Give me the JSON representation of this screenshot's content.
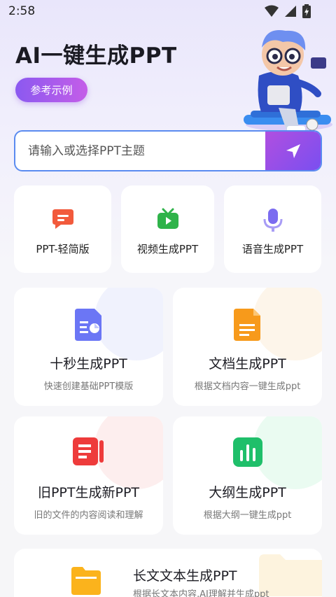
{
  "status": {
    "time": "2:58"
  },
  "hero": {
    "title": "AI一键生成PPT",
    "example_button": "参考示例"
  },
  "search": {
    "placeholder": "请输入或选择PPT主题"
  },
  "quick_tools": [
    {
      "label": "PPT-轻简版",
      "icon": "chat-bubble-icon",
      "color": "#f25a3c"
    },
    {
      "label": "视频生成PPT",
      "icon": "tv-play-icon",
      "color": "#2fb34a"
    },
    {
      "label": "语音生成PPT",
      "icon": "microphone-icon",
      "color": "#7b6cf0"
    }
  ],
  "feature_cards": [
    {
      "title": "十秒生成PPT",
      "subtitle": "快速创建基础PPT模版",
      "icon": "document-chart-icon",
      "color": "#6b76f5"
    },
    {
      "title": "文档生成PPT",
      "subtitle": "根据文档内容一键生成ppt",
      "icon": "document-icon",
      "color": "#f79a1b"
    },
    {
      "title": "旧PPT生成新PPT",
      "subtitle": "旧的文件的内容阅读和理解",
      "icon": "slides-icon",
      "color": "#ee3b3b"
    },
    {
      "title": "大纲生成PPT",
      "subtitle": "根据大纲一键生成ppt",
      "icon": "bar-chart-icon",
      "color": "#1fbf6a"
    }
  ],
  "wide_card": {
    "title": "长文文本生成PPT",
    "subtitle": "根据长文本内容,AI理解并生成ppt",
    "icon": "folder-icon",
    "color": "#fbb31c"
  }
}
